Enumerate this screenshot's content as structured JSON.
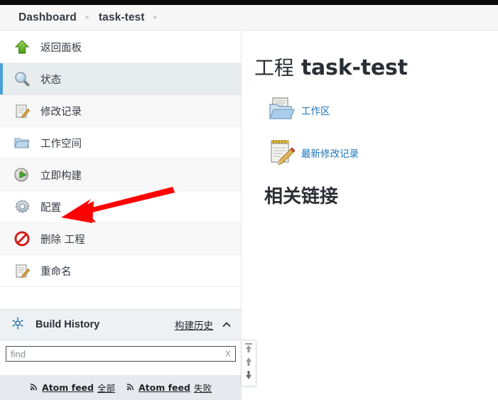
{
  "breadcrumb": {
    "items": [
      "Dashboard",
      "task-test"
    ],
    "separator": "▸"
  },
  "sidebar": {
    "items": [
      {
        "label": "返回面板",
        "icon": "up-arrow-green-icon",
        "active": false
      },
      {
        "label": "状态",
        "icon": "magnifier-icon",
        "active": true
      },
      {
        "label": "修改记录",
        "icon": "notepad-pencil-icon",
        "active": false
      },
      {
        "label": "工作空间",
        "icon": "folder-icon",
        "active": false
      },
      {
        "label": "立即构建",
        "icon": "build-clock-icon",
        "active": false
      },
      {
        "label": "配置",
        "icon": "gear-icon",
        "active": false
      },
      {
        "label": "删除 工程",
        "icon": "no-entry-icon",
        "active": false
      },
      {
        "label": "重命名",
        "icon": "notepad-pencil-icon",
        "active": false
      }
    ]
  },
  "build_history": {
    "icon": "build-history-icon",
    "title": "Build History",
    "link_label": "构建历史",
    "collapse_icon": "chevron-up-icon",
    "find": {
      "value": "",
      "placeholder": "find",
      "clear_label": "X"
    }
  },
  "feeds": [
    {
      "icon": "rss-icon",
      "label": "Atom feed",
      "scope": "全部"
    },
    {
      "icon": "rss-icon",
      "label": "Atom feed",
      "scope": "失败"
    }
  ],
  "main": {
    "title_cn": "工程",
    "title_name": "task-test",
    "links": [
      {
        "label": "工作区",
        "icon": "folder-doc-icon"
      },
      {
        "label": "最新修改记录",
        "icon": "notepad-pencil-icon"
      }
    ],
    "related_heading": "相关链接"
  },
  "scroll_widget": {
    "buttons": [
      "scroll-top-icon",
      "scroll-up-icon",
      "scroll-down-icon"
    ]
  },
  "annotation": {
    "type": "red-arrow",
    "color": "#ff0000",
    "points_to": "配置"
  },
  "colors": {
    "accent_blue": "#4b9fd5",
    "link_blue": "#1b75bb",
    "text_dark": "#333c45",
    "active_bg": "#e7ecef",
    "panel_bg": "#eef1f3",
    "feed_bg": "#e6eaee",
    "annotation_red": "#ff0000"
  }
}
